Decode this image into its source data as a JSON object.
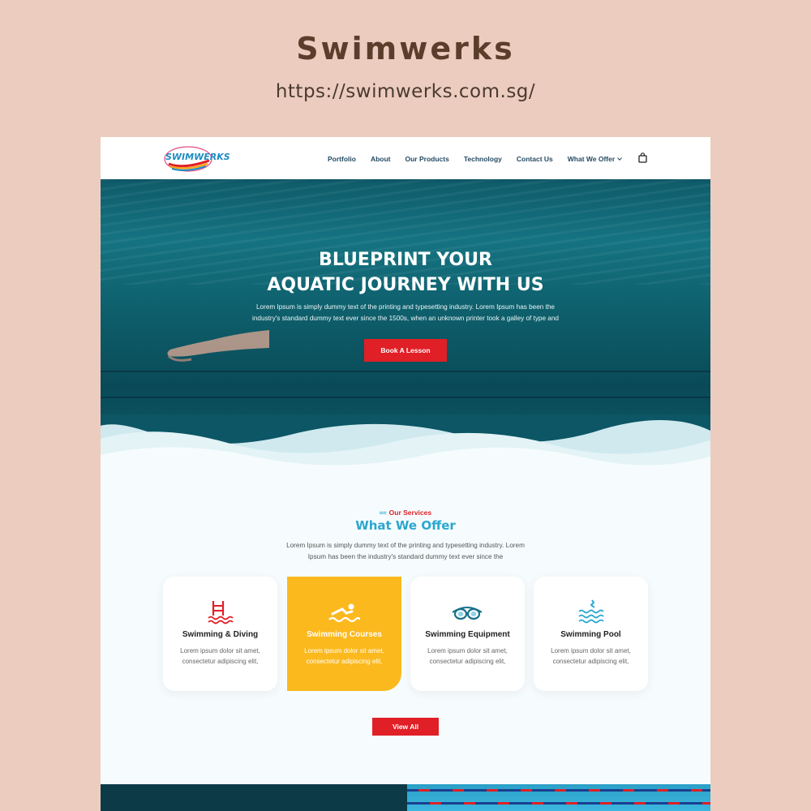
{
  "showcase": {
    "title": "Swimwerks",
    "url": "https://swimwerks.com.sg/"
  },
  "header": {
    "logo_text": "SWIMWERKS",
    "nav": [
      {
        "label": "Portfolio"
      },
      {
        "label": "About"
      },
      {
        "label": "Our Products"
      },
      {
        "label": "Technology"
      },
      {
        "label": "Contact Us"
      },
      {
        "label": "What We Offer"
      }
    ],
    "cart_icon": "shopping-bag-icon"
  },
  "hero": {
    "title_line1": "BLUEPRINT YOUR",
    "title_line2": "AQUATIC JOURNEY WITH US",
    "description": "Lorem Ipsum is simply dummy text of the printing and typesetting industry. Lorem Ipsum has been the industry's standard dummy text ever since the 1500s, when an unknown printer took a galley of type and",
    "button_label": "Book A Lesson"
  },
  "services": {
    "kicker": "Our Services",
    "title": "What We Offer",
    "description": "Lorem Ipsum is simply dummy text of the printing and typesetting industry. Lorem Ipsum has been the industry's standard dummy text ever since the",
    "cards": [
      {
        "title": "Swimming & Diving",
        "text": "Lorem ipsum dolor sit amet, consectetur adipiscing elit,",
        "icon": "pool-ladder-icon"
      },
      {
        "title": "Swimming Courses",
        "text": "Lorem ipsum dolor sit amet, consectetur adipiscing elit,",
        "icon": "swimmer-icon"
      },
      {
        "title": "Swimming Equipment",
        "text": "Lorem ipsum dolor sit amet, consectetur adipiscing elit,",
        "icon": "goggles-icon"
      },
      {
        "title": "Swimming Pool",
        "text": "Lorem ipsum dolor sit amet, consectetur adipiscing elit,",
        "icon": "pool-icon"
      }
    ],
    "view_all_label": "View All"
  },
  "colors": {
    "page_bg": "#ecccbf",
    "brand_red": "#e01f26",
    "brand_blue": "#2aa7d0",
    "accent_yellow": "#fbb91e",
    "hero_teal": "#0e5f6c"
  }
}
